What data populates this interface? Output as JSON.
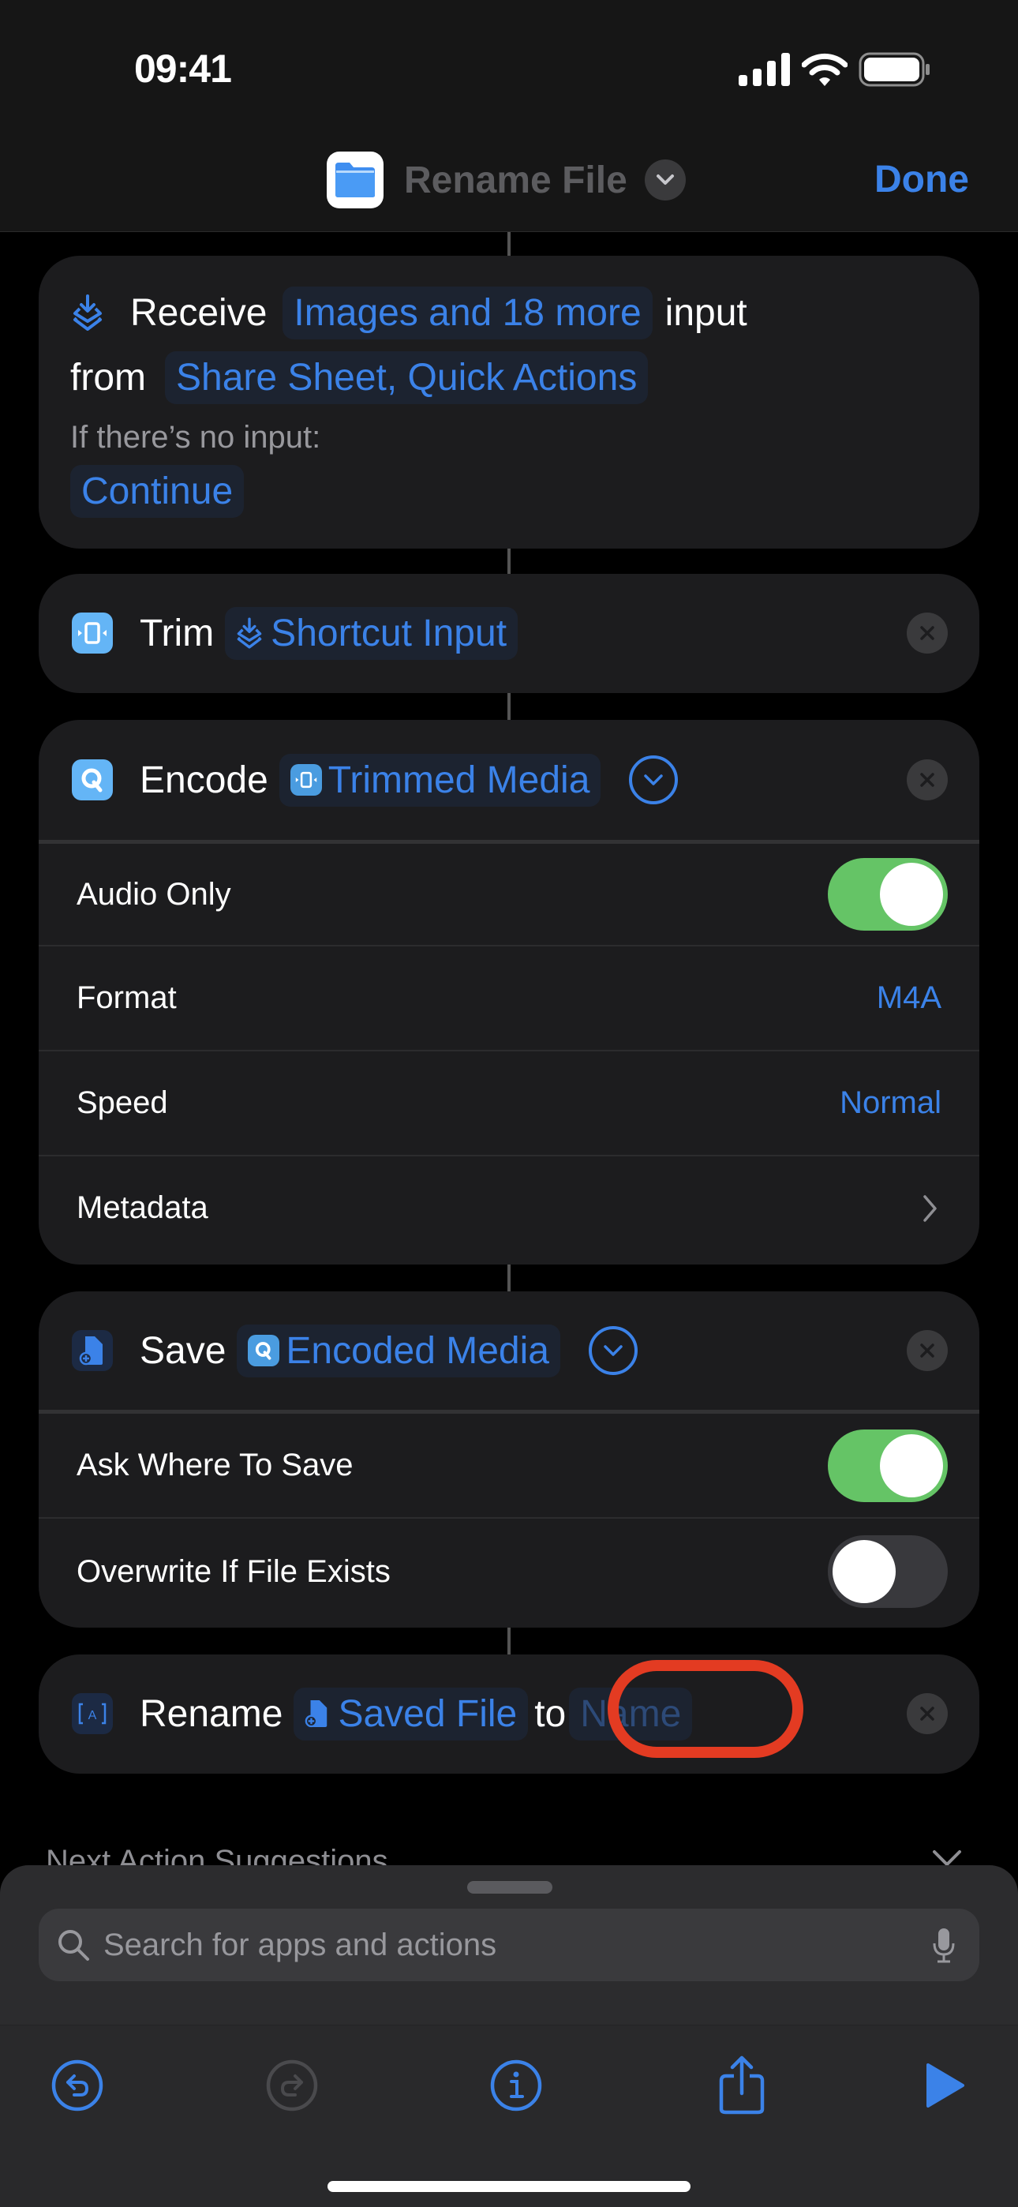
{
  "status_bar": {
    "time": "09:41",
    "icons": [
      "cellular-signal-icon",
      "wifi-icon",
      "battery-icon"
    ]
  },
  "navbar": {
    "title": "Rename File",
    "app_icon": "files-folder-icon",
    "done_label": "Done"
  },
  "colors": {
    "accent": "#3b82e8",
    "toggle_on": "#65c466",
    "highlight": "#e33b22",
    "card": "#1c1c1e"
  },
  "actions": {
    "receive": {
      "verb": "Receive",
      "types_token": "Images and 18 more",
      "word_input": "input",
      "word_from": "from",
      "sources_token": "Share Sheet, Quick Actions",
      "no_input_label": "If there’s no input:",
      "no_input_value": "Continue"
    },
    "trim": {
      "verb": "Trim",
      "input_token": "Shortcut Input"
    },
    "encode": {
      "verb": "Encode",
      "input_token": "Trimmed Media",
      "params": [
        {
          "label": "Audio Only",
          "type": "toggle",
          "on": true
        },
        {
          "label": "Format",
          "type": "value",
          "value": "M4A"
        },
        {
          "label": "Speed",
          "type": "value",
          "value": "Normal"
        },
        {
          "label": "Metadata",
          "type": "disclosure"
        }
      ]
    },
    "save": {
      "verb": "Save",
      "input_token": "Encoded Media",
      "params": [
        {
          "label": "Ask Where To Save",
          "type": "toggle",
          "on": true
        },
        {
          "label": "Overwrite If File Exists",
          "type": "toggle",
          "on": false
        }
      ]
    },
    "rename": {
      "verb": "Rename",
      "input_token": "Saved File",
      "word_to": "to",
      "name_placeholder": "Name"
    }
  },
  "suggestions": {
    "label": "Next Action Suggestions"
  },
  "search": {
    "placeholder": "Search for apps and actions",
    "value": ""
  },
  "toolbar": {
    "buttons": [
      "undo",
      "redo",
      "info",
      "share",
      "run"
    ]
  }
}
